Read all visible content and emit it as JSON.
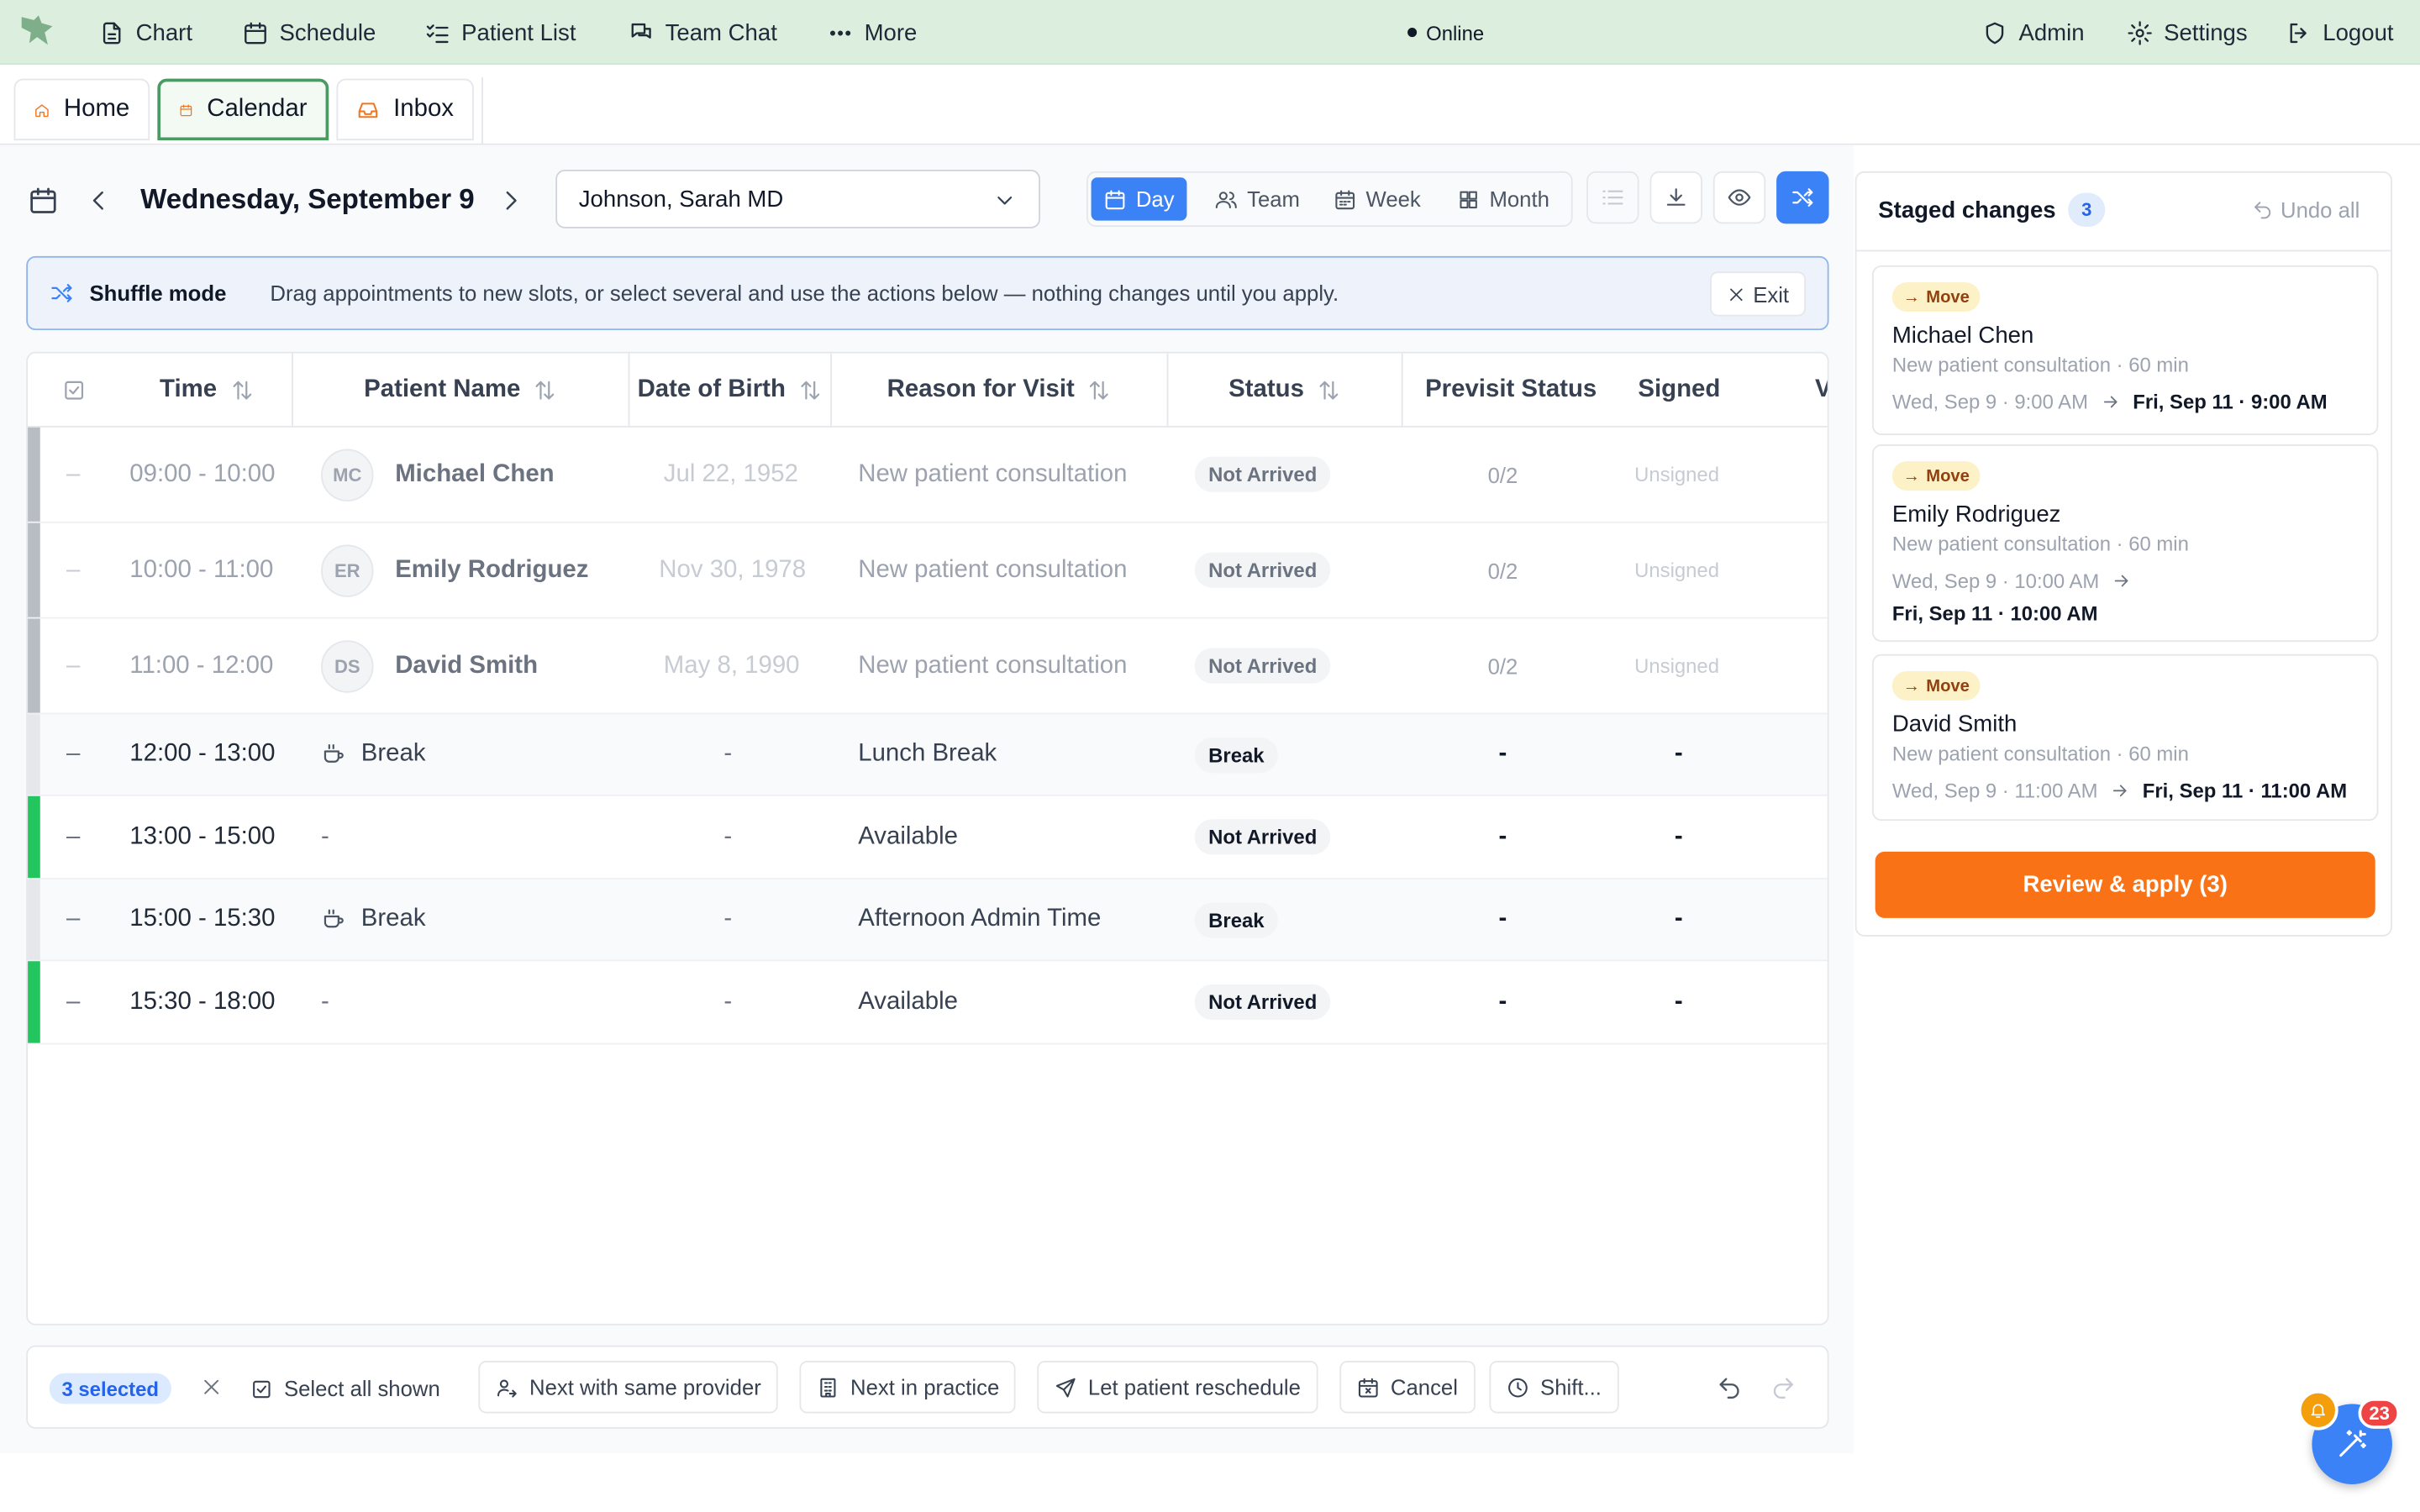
{
  "nav": {
    "items": [
      {
        "label": "Chart",
        "icon": "document-icon"
      },
      {
        "label": "Schedule",
        "icon": "calendar-icon"
      },
      {
        "label": "Patient List",
        "icon": "list-check-icon"
      },
      {
        "label": "Team Chat",
        "icon": "chat-icon"
      },
      {
        "label": "More",
        "icon": "more-dots-icon"
      }
    ],
    "status": "Online",
    "right": [
      {
        "label": "Admin",
        "icon": "shield-icon"
      },
      {
        "label": "Settings",
        "icon": "gear-icon"
      },
      {
        "label": "Logout",
        "icon": "logout-icon"
      }
    ]
  },
  "tabs": [
    {
      "label": "Home",
      "icon": "home-icon",
      "active": false
    },
    {
      "label": "Calendar",
      "icon": "calendar-icon",
      "active": true
    },
    {
      "label": "Inbox",
      "icon": "inbox-icon",
      "active": false
    }
  ],
  "toolbar": {
    "date_title": "Wednesday, September 9",
    "provider": "Johnson, Sarah MD",
    "views": [
      "Day",
      "Team",
      "Week",
      "Month"
    ],
    "active_view": "Day"
  },
  "banner": {
    "title": "Shuffle mode",
    "text": "Drag appointments to new slots, or select several and use the actions below — nothing changes until you apply.",
    "exit_label": "Exit"
  },
  "table": {
    "headers": [
      "Time",
      "Patient Name",
      "Date of Birth",
      "Reason for Visit",
      "Status",
      "Previsit Status",
      "Signed",
      "V"
    ],
    "rows": [
      {
        "select": "–",
        "time": "09:00 - 10:00",
        "initials": "MC",
        "patient": "Michael Chen",
        "dob": "Jul 22, 1952",
        "reason": "New patient consultation",
        "status": "Not Arrived",
        "previsit": "0/2",
        "signed": "Unsigned",
        "staged": true
      },
      {
        "select": "–",
        "time": "10:00 - 11:00",
        "initials": "ER",
        "patient": "Emily Rodriguez",
        "dob": "Nov 30, 1978",
        "reason": "New patient consultation",
        "status": "Not Arrived",
        "previsit": "0/2",
        "signed": "Unsigned",
        "staged": true
      },
      {
        "select": "–",
        "time": "11:00 - 12:00",
        "initials": "DS",
        "patient": "David Smith",
        "dob": "May 8, 1990",
        "reason": "New patient consultation",
        "status": "Not Arrived",
        "previsit": "0/2",
        "signed": "Unsigned",
        "staged": true
      },
      {
        "select": "–",
        "time": "12:00 - 13:00",
        "patient": "Break",
        "dob": "-",
        "reason": "Lunch Break",
        "status": "Break",
        "previsit": "-",
        "signed": "-",
        "kind": "break"
      },
      {
        "select": "–",
        "time": "13:00 - 15:00",
        "patient": "-",
        "dob": "-",
        "reason": "Available",
        "status": "Not Arrived",
        "previsit": "-",
        "signed": "-",
        "kind": "available"
      },
      {
        "select": "–",
        "time": "15:00 - 15:30",
        "patient": "Break",
        "dob": "-",
        "reason": "Afternoon Admin Time",
        "status": "Break",
        "previsit": "-",
        "signed": "-",
        "kind": "break"
      },
      {
        "select": "–",
        "time": "15:30 - 18:00",
        "patient": "-",
        "dob": "-",
        "reason": "Available",
        "status": "Not Arrived",
        "previsit": "-",
        "signed": "-",
        "kind": "available"
      }
    ]
  },
  "actions": {
    "selected_label": "3 selected",
    "select_all": "Select all shown",
    "next_same_provider": "Next with same provider",
    "next_in_practice": "Next in practice",
    "let_patient_reschedule": "Let patient reschedule",
    "cancel": "Cancel",
    "shift": "Shift..."
  },
  "staged": {
    "title": "Staged changes",
    "count": "3",
    "undo_all": "Undo all",
    "changes": [
      {
        "badge": "Move",
        "name": "Michael Chen",
        "desc": "New patient consultation · 60 min",
        "from": "Wed, Sep 9 · 9:00 AM",
        "to": "Fri, Sep 11 · 9:00 AM"
      },
      {
        "badge": "Move",
        "name": "Emily Rodriguez",
        "desc": "New patient consultation · 60 min",
        "from": "Wed, Sep 9 · 10:00 AM",
        "to": "Fri, Sep 11 · 10:00 AM"
      },
      {
        "badge": "Move",
        "name": "David Smith",
        "desc": "New patient consultation · 60 min",
        "from": "Wed, Sep 9 · 11:00 AM",
        "to": "Fri, Sep 11 · 11:00 AM"
      }
    ],
    "apply_label": "Review & apply (3)"
  },
  "fab": {
    "count": "23"
  },
  "colors": {
    "accent": "#3b82f6",
    "apply": "#f97316",
    "available": "#22c55e",
    "staged": "#b8bcc3",
    "nav_bg": "#dcefdf"
  }
}
